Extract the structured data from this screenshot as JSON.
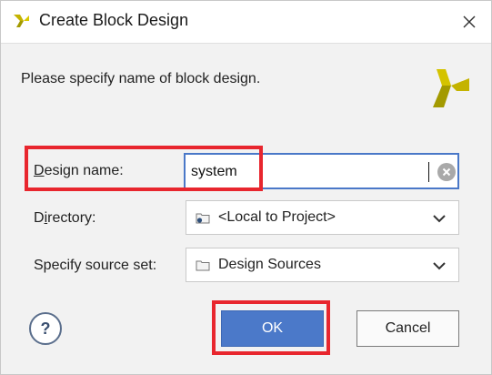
{
  "window": {
    "title": "Create Block Design",
    "close_icon": "close-icon"
  },
  "message": "Please specify name of block design.",
  "brand": {
    "color_gold": "#c4b300",
    "color_olive": "#a39a00"
  },
  "form": {
    "design_name": {
      "label_mnemonic": "D",
      "label_rest": "esign name:",
      "value": "system"
    },
    "directory": {
      "label_pre": "D",
      "label_mnemonic": "i",
      "label_rest": "rectory:",
      "value": "<Local to Project>",
      "icon": "folder-icon"
    },
    "source_set": {
      "label": "Specify source set:",
      "value": "Design Sources",
      "icon": "folder-icon"
    }
  },
  "buttons": {
    "help": "?",
    "ok": "OK",
    "cancel": "Cancel"
  },
  "colors": {
    "accent": "#4b79c9",
    "highlight": "#e8262e"
  }
}
